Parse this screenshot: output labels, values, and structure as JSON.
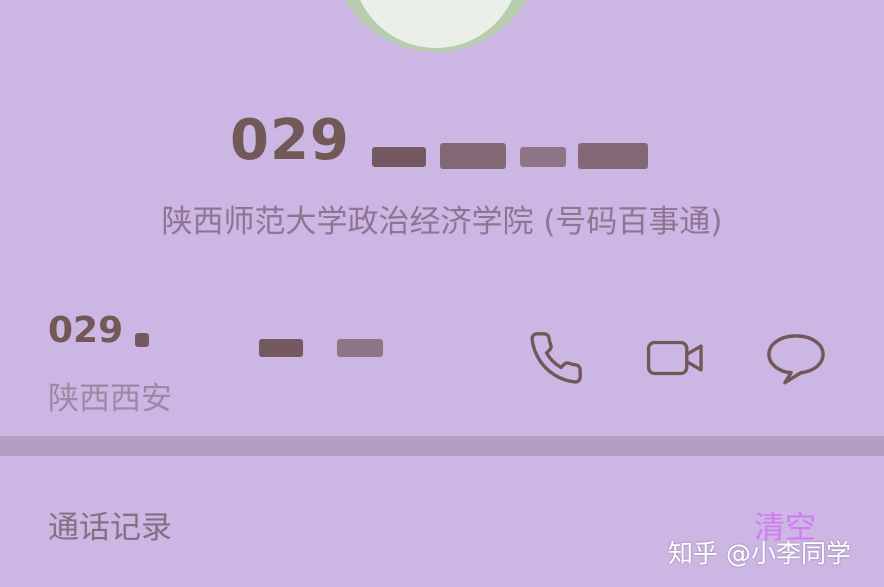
{
  "header": {
    "number_prefix": "029",
    "company": "陕西师范大学政治经济学院 (号码百事通)"
  },
  "contact": {
    "number_prefix": "029",
    "location": "陕西西安"
  },
  "actions": [
    {
      "name": "phone-icon"
    },
    {
      "name": "video-call-icon"
    },
    {
      "name": "message-icon"
    }
  ],
  "history": {
    "title": "通话记录",
    "clear_label": "清空"
  },
  "watermark": "知乎 @小李同学",
  "colors": {
    "background": "#cbb6e4",
    "number_text": "#735858",
    "accent_clear": "#d47af4",
    "divider": "#b69dc3"
  }
}
